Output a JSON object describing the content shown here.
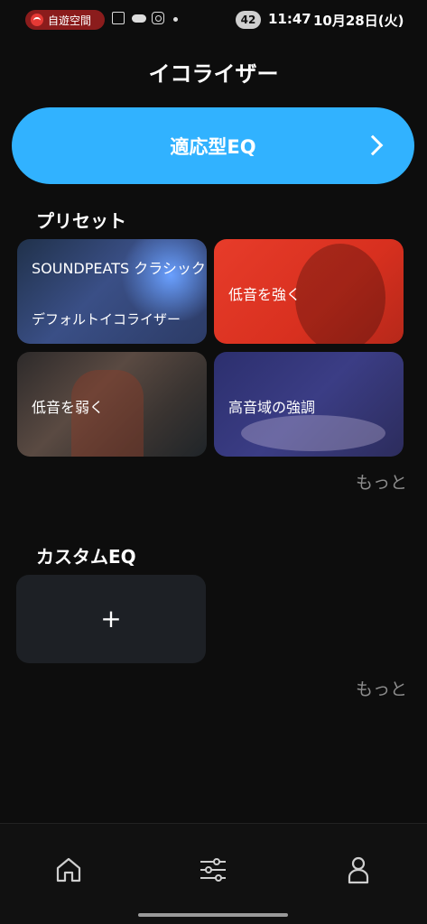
{
  "status_bar": {
    "notification": "自遊空間",
    "battery_level": "42",
    "time": "11:47",
    "date": "10月28日(火)",
    "icons": [
      "spotify-icon",
      "scan-icon",
      "cloud-icon",
      "instagram-icon",
      "dot-icon"
    ]
  },
  "header": {
    "title": "イコライザー"
  },
  "adaptive_eq": {
    "label": "適応型EQ"
  },
  "presets": {
    "section_title": "プリセット",
    "items": [
      {
        "label": "SOUNDPEATS クラシック",
        "sublabel": "デフォルトイコライザー"
      },
      {
        "label": "低音を強く"
      },
      {
        "label": "低音を弱く"
      },
      {
        "label": "高音域の強調"
      }
    ],
    "more_label": "もっと"
  },
  "custom_eq": {
    "section_title": "カスタムEQ",
    "add_label": "+",
    "more_label": "もっと"
  },
  "bottom_nav": {
    "items": [
      {
        "icon": "home-icon"
      },
      {
        "icon": "equalizer-sliders-icon"
      },
      {
        "icon": "profile-icon"
      }
    ]
  },
  "colors": {
    "background": "#0d0d0d",
    "accent": "#31b2ff",
    "muted_text": "#8d8d8d"
  }
}
